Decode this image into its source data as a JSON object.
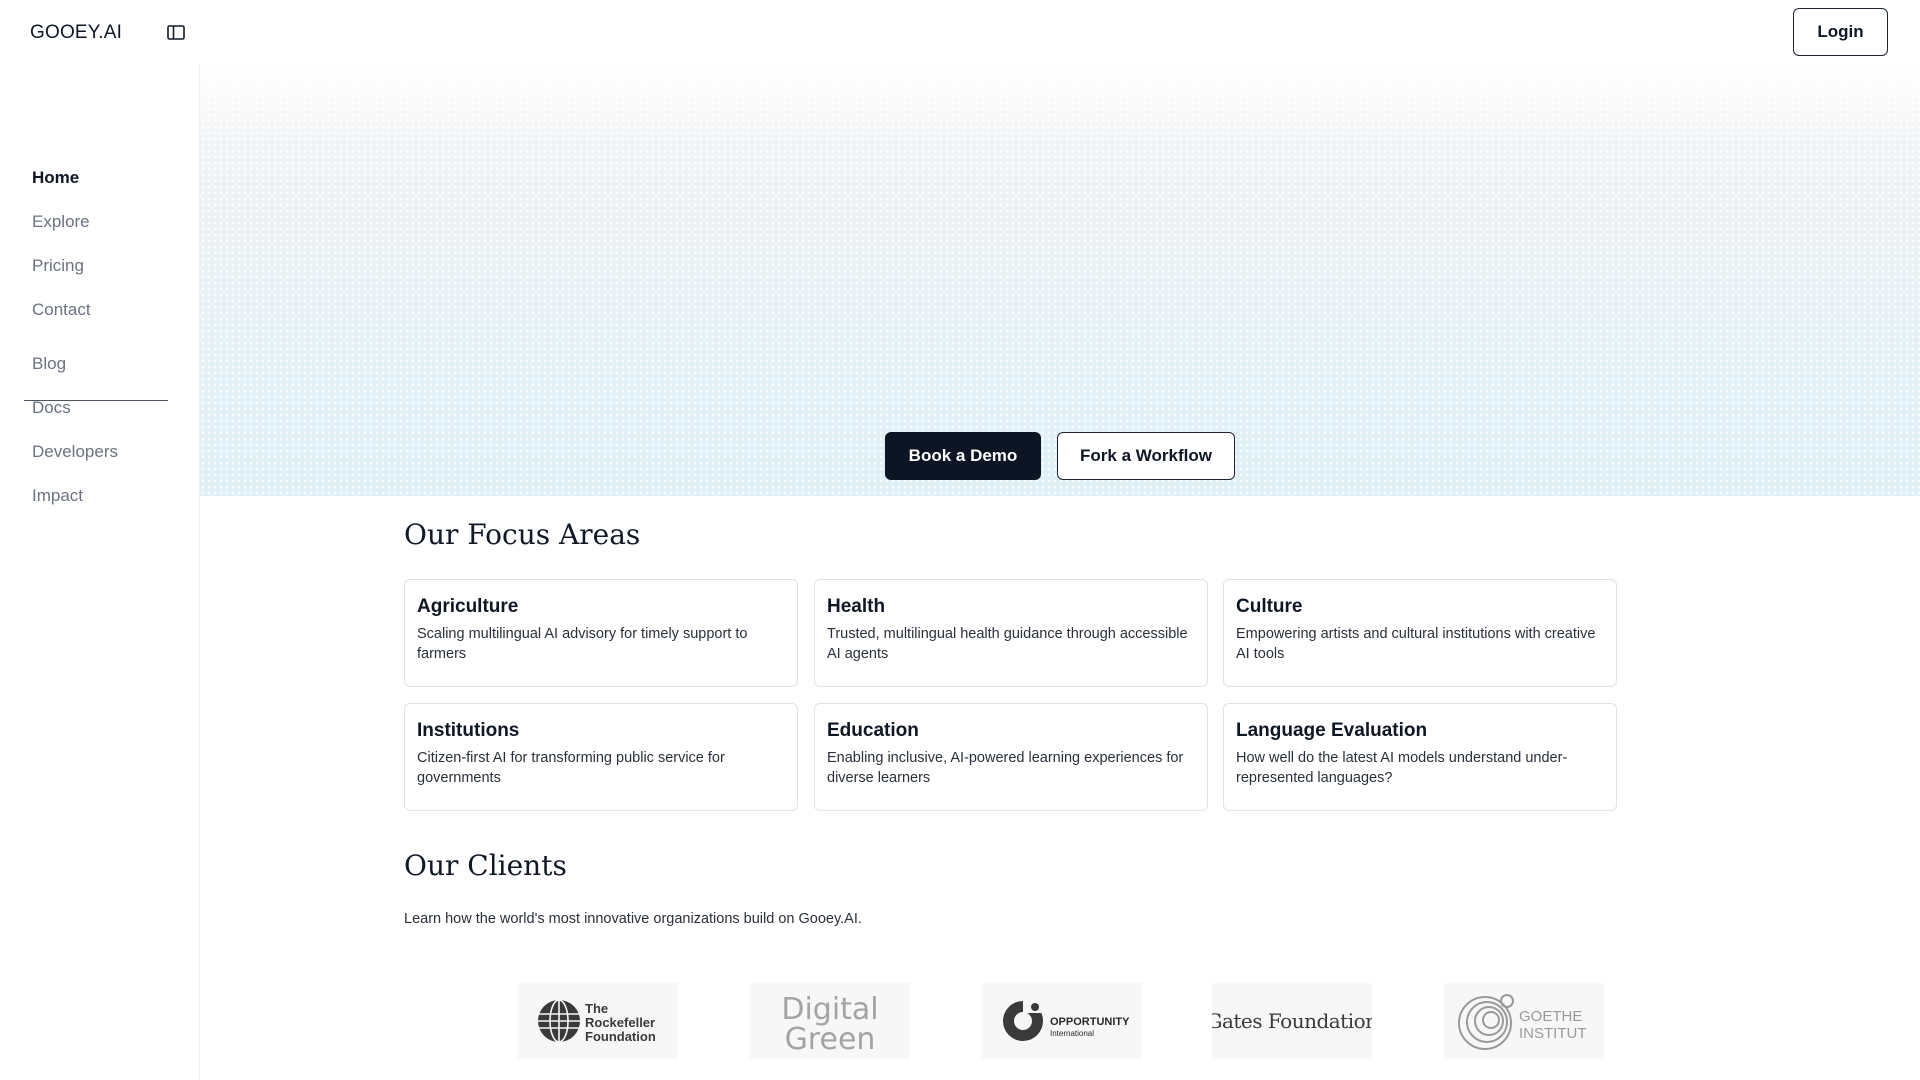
{
  "brand": {
    "logo_text": "GOOEY.AI"
  },
  "header": {
    "login_label": "Login"
  },
  "sidebar": {
    "items": [
      {
        "label": "Home",
        "active": true
      },
      {
        "label": "Explore"
      },
      {
        "label": "Pricing"
      },
      {
        "label": "Contact"
      },
      {
        "label": "Blog"
      },
      {
        "label": "Docs"
      },
      {
        "label": "Developers"
      },
      {
        "label": "Impact"
      }
    ]
  },
  "hero": {
    "primary_cta": "Book a Demo",
    "secondary_cta": "Fork a Workflow"
  },
  "focus": {
    "title": "Our Focus Areas",
    "cards": [
      {
        "title": "Agriculture",
        "desc": "Scaling multilingual AI advisory for timely support to farmers"
      },
      {
        "title": "Health",
        "desc": "Trusted, multilingual health guidance through accessible AI agents"
      },
      {
        "title": "Culture",
        "desc": "Empowering artists and cultural institutions with creative AI tools"
      },
      {
        "title": "Institutions",
        "desc": "Citizen-first AI for transforming public service for governments"
      },
      {
        "title": "Education",
        "desc": "Enabling inclusive, AI-powered learning experiences for diverse learners"
      },
      {
        "title": "Language Evaluation",
        "desc": "How well do the latest AI models understand under-represented languages?"
      }
    ]
  },
  "clients": {
    "title": "Our Clients",
    "subtitle": "Learn how the world's most innovative organizations build on Gooey.AI.",
    "logos": [
      {
        "name": "The Rockefeller Foundation",
        "line1": "The",
        "line2": "Rockefeller",
        "line3": "Foundation"
      },
      {
        "name": "Digital Green",
        "line1": "Digital",
        "line2": "Green"
      },
      {
        "name": "Opportunity International",
        "line1": "OPPORTUNITY",
        "line2": "International"
      },
      {
        "name": "Gates Foundation",
        "line1": "Gates Foundation"
      },
      {
        "name": "Goethe Institut",
        "line1": "GOETHE",
        "line2": "INSTITUT"
      }
    ]
  },
  "colors": {
    "primary_dark": "#0d1424",
    "hero_tint": "#ddeff6",
    "muted_text": "#6b7280"
  }
}
